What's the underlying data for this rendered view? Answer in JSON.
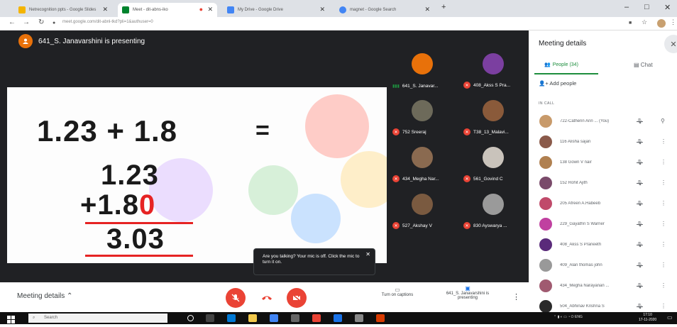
{
  "browser": {
    "tabs": [
      {
        "label": "Netrecognition ppts - Google Slides",
        "icon": "slides-icon",
        "color": "#f4b400"
      },
      {
        "label": "Meet - dit-abns-iko",
        "icon": "meet-icon",
        "color": "#00832d"
      },
      {
        "label": "My Drive - Google Drive",
        "icon": "drive-icon",
        "color": "#4285f4"
      },
      {
        "label": "magnet - Google Search",
        "icon": "google-icon",
        "color": "#4285f4"
      }
    ],
    "url": "meet.google.com/dit-abnl-tkd?pli=1&authuser=0"
  },
  "presenter": {
    "text": "641_S. Janavarshini is presenting"
  },
  "slide": {
    "equation_top": "1.23 + 1.8",
    "equals": "=",
    "line1": "1.23",
    "line2_prefix": "+1.8",
    "line2_suffix": "0",
    "result": "3.03"
  },
  "participants_grid": [
    {
      "name": "641_S. Janavar...",
      "speaking": true,
      "avatar_color": "#e8710a"
    },
    {
      "name": "408_Akss S Pra...",
      "speaking": false,
      "avatar_color": "#7b3fa0"
    },
    {
      "name": "752 Sreeraj",
      "speaking": false,
      "avatar_color": "#6d6a5a"
    },
    {
      "name": "T38_13_Malavi...",
      "speaking": false,
      "avatar_color": "#8a5a3a"
    },
    {
      "name": "434_Megha Nar...",
      "speaking": false,
      "avatar_color": "#8a6a50"
    },
    {
      "name": "561_Govind C",
      "speaking": false,
      "avatar_color": "#c9c3bb"
    },
    {
      "name": "527_Akshay V",
      "speaking": false,
      "avatar_color": "#7a5a40"
    },
    {
      "name": "830 Ayswarya ...",
      "speaking": false,
      "avatar_color": "#9a9a9a"
    }
  ],
  "tooltip": {
    "text": "Are you talking? Your mic is off. Click the mic to turn it on."
  },
  "bottom_bar": {
    "meeting_details": "Meeting details",
    "captions_label": "Turn on captions",
    "presenting_label": "641_S. Janavarshini is presenting"
  },
  "panel": {
    "title": "Meeting details",
    "people_tab": "People (34)",
    "chat_tab": "Chat",
    "add_people": "Add people",
    "in_call": "IN CALL",
    "people": [
      {
        "name": "722-Catherin Ann ... (You)",
        "avatar_color": "#c89a6a",
        "extra_icon": true
      },
      {
        "name": "116 Alisha sajan",
        "avatar_color": "#8a5a4a"
      },
      {
        "name": "138 Gowri V nair",
        "avatar_color": "#b08050"
      },
      {
        "name": "152 Rohit Ajith",
        "avatar_color": "#7a4a6a"
      },
      {
        "name": "205 Afreen A.Habeeb",
        "avatar_color": "#c04a6a"
      },
      {
        "name": "229_Gayathri S Warrier",
        "avatar_color": "#c040a0"
      },
      {
        "name": "408_Akss S Praneeth",
        "avatar_color": "#5a2a7a"
      },
      {
        "name": "409_Alan thomas john",
        "avatar_color": "#999999"
      },
      {
        "name": "434_Megha Narayanan ...",
        "avatar_color": "#a05a70"
      },
      {
        "name": "504_Abhinav Krishna S",
        "avatar_color": "#2a2a2a"
      }
    ]
  },
  "taskbar": {
    "search": "Search",
    "clock_time": "17:10",
    "clock_date": "17-11-2020",
    "tray": "ENG"
  },
  "colors": {
    "meet_dark": "#202124",
    "accent_green": "#1e8e3e",
    "mic_red": "#ea4335",
    "slide_red": "#e62323"
  }
}
